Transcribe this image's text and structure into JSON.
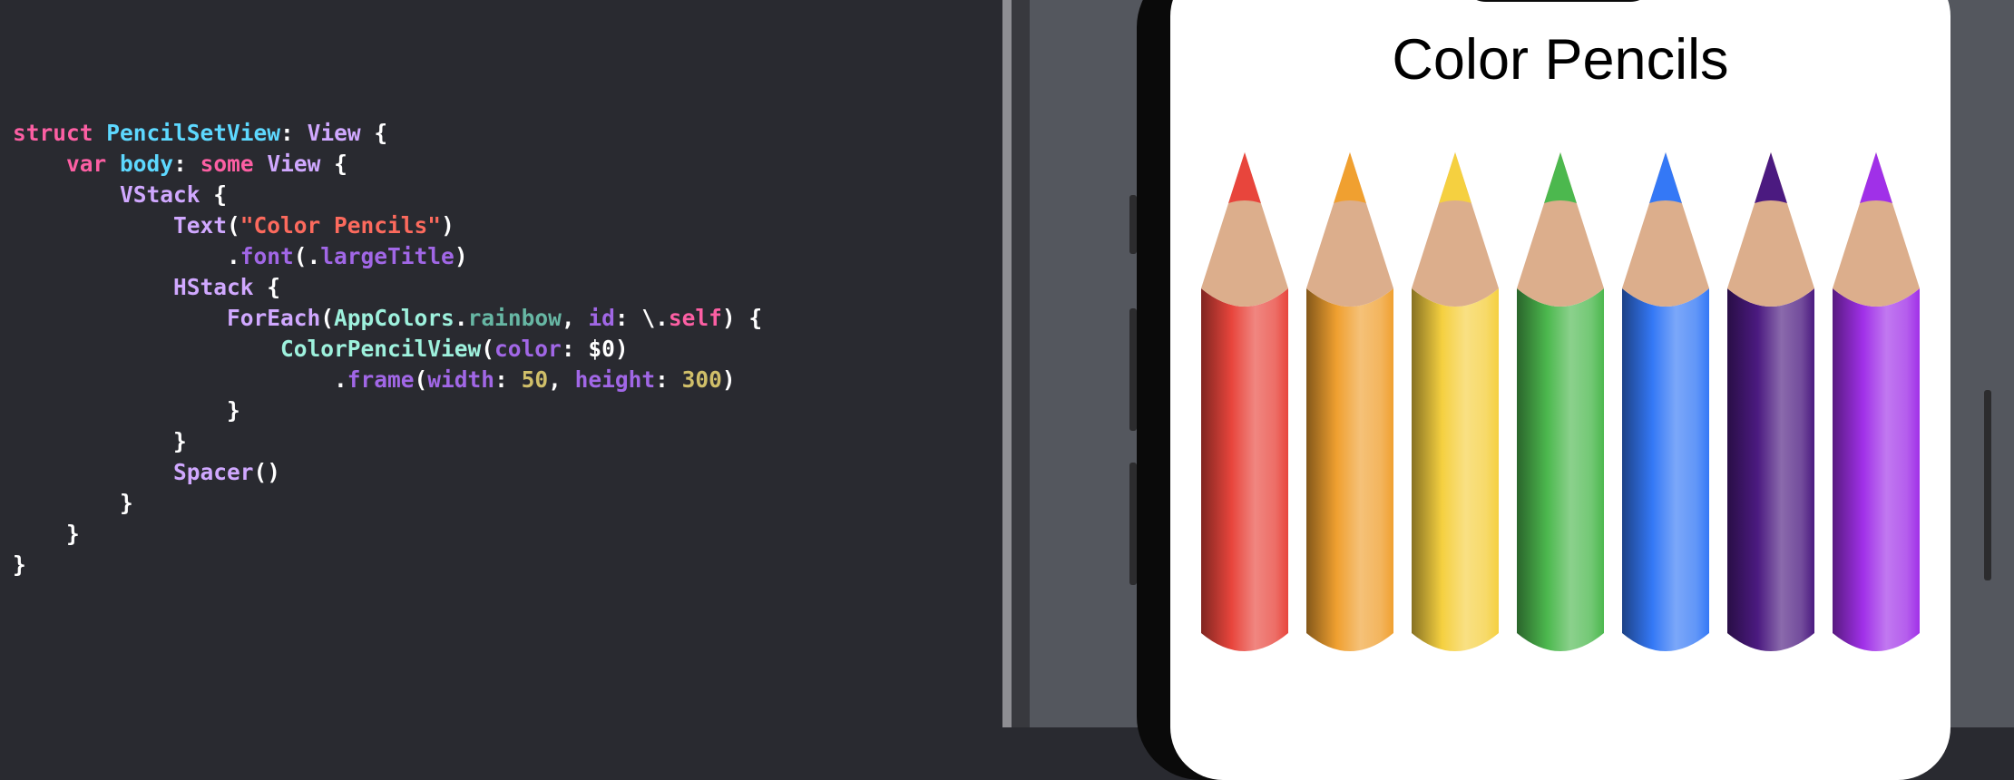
{
  "editor": {
    "code_lines": [
      [
        {
          "t": "struct",
          "c": "keyword"
        },
        {
          "t": " ",
          "c": "plain"
        },
        {
          "t": "PencilSetView",
          "c": "typedecl"
        },
        {
          "t": ": ",
          "c": "plain"
        },
        {
          "t": "View",
          "c": "type"
        },
        {
          "t": " {",
          "c": "plain"
        }
      ],
      [
        {
          "t": "    ",
          "c": "plain"
        },
        {
          "t": "var",
          "c": "keyword"
        },
        {
          "t": " ",
          "c": "plain"
        },
        {
          "t": "body",
          "c": "typedecl"
        },
        {
          "t": ": ",
          "c": "plain"
        },
        {
          "t": "some",
          "c": "keyword"
        },
        {
          "t": " ",
          "c": "plain"
        },
        {
          "t": "View",
          "c": "type"
        },
        {
          "t": " {",
          "c": "plain"
        }
      ],
      [
        {
          "t": "        ",
          "c": "plain"
        },
        {
          "t": "VStack",
          "c": "type"
        },
        {
          "t": " {",
          "c": "plain"
        }
      ],
      [
        {
          "t": "            ",
          "c": "plain"
        },
        {
          "t": "Text",
          "c": "type"
        },
        {
          "t": "(",
          "c": "plain"
        },
        {
          "t": "\"Color Pencils\"",
          "c": "string"
        },
        {
          "t": ")",
          "c": "plain"
        }
      ],
      [
        {
          "t": "                .",
          "c": "plain"
        },
        {
          "t": "font",
          "c": "call"
        },
        {
          "t": "(.",
          "c": "plain"
        },
        {
          "t": "largeTitle",
          "c": "call"
        },
        {
          "t": ")",
          "c": "plain"
        }
      ],
      [
        {
          "t": "            ",
          "c": "plain"
        },
        {
          "t": "HStack",
          "c": "type"
        },
        {
          "t": " {",
          "c": "plain"
        }
      ],
      [
        {
          "t": "                ",
          "c": "plain"
        },
        {
          "t": "ForEach",
          "c": "type"
        },
        {
          "t": "(",
          "c": "plain"
        },
        {
          "t": "AppColors",
          "c": "typename"
        },
        {
          "t": ".",
          "c": "plain"
        },
        {
          "t": "rainbow",
          "c": "prop"
        },
        {
          "t": ", ",
          "c": "plain"
        },
        {
          "t": "id",
          "c": "label"
        },
        {
          "t": ": \\.",
          "c": "plain"
        },
        {
          "t": "self",
          "c": "keyword"
        },
        {
          "t": ") {",
          "c": "plain"
        }
      ],
      [
        {
          "t": "                    ",
          "c": "plain"
        },
        {
          "t": "ColorPencilView",
          "c": "typename"
        },
        {
          "t": "(",
          "c": "plain"
        },
        {
          "t": "color",
          "c": "label"
        },
        {
          "t": ": $0)",
          "c": "plain"
        }
      ],
      [
        {
          "t": "                        .",
          "c": "plain"
        },
        {
          "t": "frame",
          "c": "call"
        },
        {
          "t": "(",
          "c": "plain"
        },
        {
          "t": "width",
          "c": "label"
        },
        {
          "t": ": ",
          "c": "plain"
        },
        {
          "t": "50",
          "c": "number"
        },
        {
          "t": ", ",
          "c": "plain"
        },
        {
          "t": "height",
          "c": "label"
        },
        {
          "t": ": ",
          "c": "plain"
        },
        {
          "t": "300",
          "c": "number"
        },
        {
          "t": ")",
          "c": "plain"
        }
      ],
      [
        {
          "t": "                }",
          "c": "plain"
        }
      ],
      [
        {
          "t": "            }",
          "c": "plain"
        }
      ],
      [
        {
          "t": "            ",
          "c": "plain"
        },
        {
          "t": "Spacer",
          "c": "type"
        },
        {
          "t": "()",
          "c": "plain"
        }
      ],
      [
        {
          "t": "        }",
          "c": "plain"
        }
      ],
      [
        {
          "t": "    }",
          "c": "plain"
        }
      ],
      [
        {
          "t": "}",
          "c": "plain"
        }
      ]
    ]
  },
  "preview": {
    "title": "Color Pencils",
    "pencils": [
      {
        "color": "#e8453c"
      },
      {
        "color": "#f0a030"
      },
      {
        "color": "#f5d040"
      },
      {
        "color": "#4cb84e"
      },
      {
        "color": "#3478f6"
      },
      {
        "color": "#4b1a80"
      },
      {
        "color": "#a030e8"
      }
    ],
    "wood_color": "#dcae8c"
  }
}
